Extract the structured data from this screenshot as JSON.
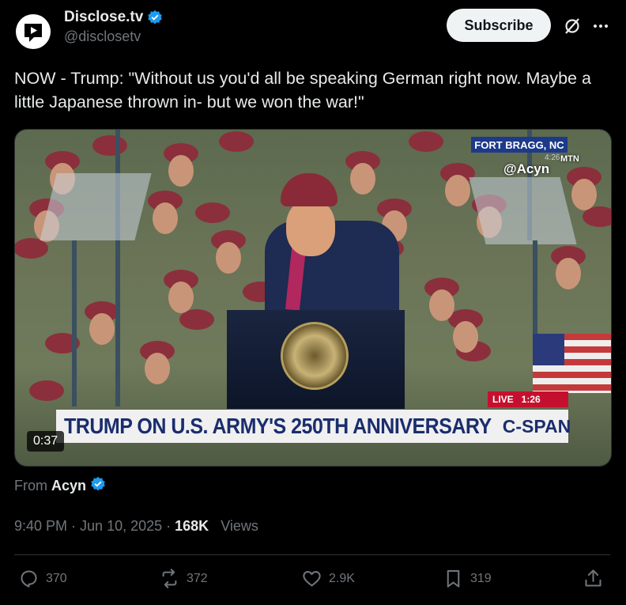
{
  "author": {
    "display_name": "Disclose.tv",
    "handle": "@disclosetv",
    "verified": true
  },
  "header": {
    "subscribe_label": "Subscribe",
    "grok_icon": "grok-icon",
    "more_icon": "more-icon"
  },
  "tweet": {
    "text": "NOW - Trump: \"Without us you'd all be speaking German right now. Maybe a little Japanese thrown in- but we won the war!\""
  },
  "video": {
    "duration": "0:37",
    "location": "FORT BRAGG, NC",
    "location_time": "4:26",
    "watermark": "@Acyn",
    "watermark_mtn": "MTN",
    "live_label": "LIVE",
    "live_time": "1:26",
    "lower_third": "TRUMP ON U.S. ARMY'S 250TH ANNIVERSARY",
    "network": "C-SPAN"
  },
  "source": {
    "prefix": "From",
    "name": "Acyn",
    "verified": true
  },
  "meta": {
    "time": "9:40 PM",
    "separator": " · ",
    "date": "Jun 10, 2025",
    "views_count": "168K",
    "views_label": "Views"
  },
  "actions": {
    "replies": "370",
    "reposts": "372",
    "likes": "2.9K",
    "bookmarks": "319"
  },
  "colors": {
    "background": "#000000",
    "verified_badge": "#1d9bf0",
    "text_primary": "#e7e9ea",
    "text_secondary": "#71767b"
  }
}
